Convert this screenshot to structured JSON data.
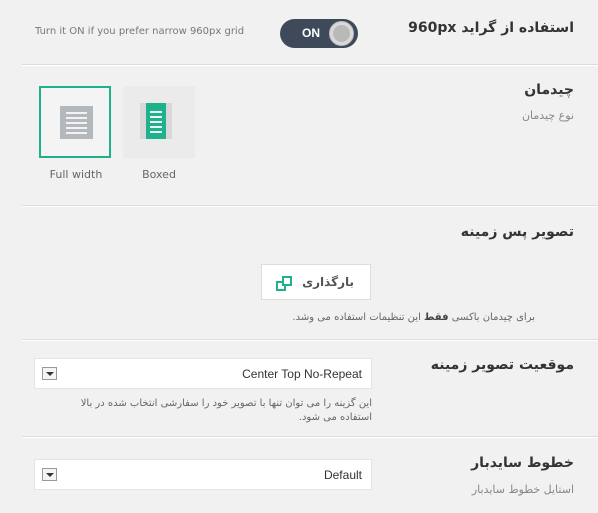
{
  "grid_row": {
    "title": "استفاده از گراید 960px",
    "hint": "Turn it ON if you prefer narrow 960px grid",
    "toggle_label": "ON",
    "toggle_state": true
  },
  "layout_row": {
    "title": "چیدمان",
    "subtitle": "نوع چیدمان",
    "options": [
      {
        "label": "Full width",
        "icon": "full-width-icon",
        "selected": true
      },
      {
        "label": "Boxed",
        "icon": "boxed-icon",
        "selected": false
      }
    ]
  },
  "bg_image_row": {
    "title": "تصویر پس زمینه",
    "upload_label": "بارگذاری",
    "upload_icon": "upload-icon",
    "note_prefix": "برای چیدمان باکسی",
    "note_bold": "فقط",
    "note_suffix": "این تنظیمات استفاده می وشد."
  },
  "bg_position_row": {
    "title": "موقعیت تصویر زمینه",
    "selected": "Center Top No-Repeat",
    "desc_line1": "این گزینه را می توان تنها با تصویر خود را سفارشی انتخاب شده در بالا",
    "desc_line2": "استفاده می شود."
  },
  "sidebar_lines_row": {
    "title": "خطوط سایدبار",
    "subtitle": "استایل خطوط سایدبار",
    "selected": "Default"
  },
  "colors": {
    "accent": "#1fb08c",
    "toggle_bg": "#3e4a5a",
    "page_bg": "#f1f1f1"
  }
}
